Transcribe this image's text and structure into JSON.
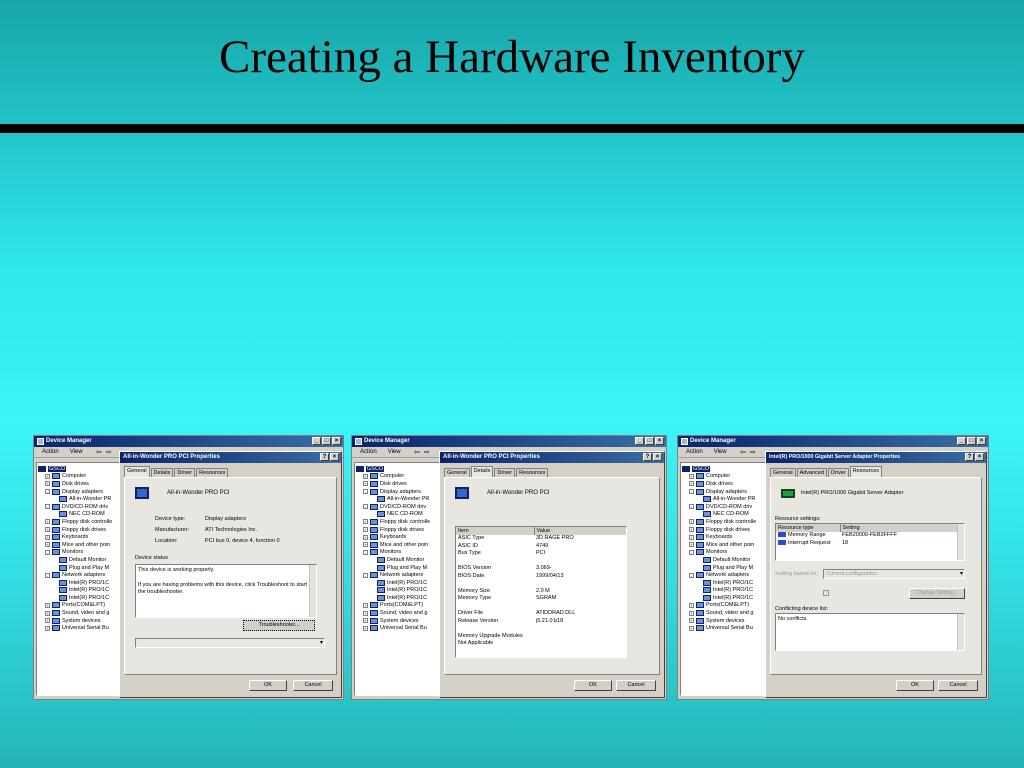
{
  "slide_title": "Creating a Hardware Inventory",
  "device_manager": {
    "title": "Device Manager",
    "menu": [
      "Action",
      "View"
    ],
    "tree": [
      {
        "label": "GSCO",
        "level": 0,
        "root": true
      },
      {
        "label": "Computer",
        "level": 1,
        "exp": "+"
      },
      {
        "label": "Disk drives",
        "level": 1,
        "exp": "+"
      },
      {
        "label": "Display adapters",
        "level": 1,
        "exp": "-"
      },
      {
        "label": "All-in-Wonder PR",
        "level": 2
      },
      {
        "label": "DVD/CD-ROM driv",
        "level": 1,
        "exp": "-"
      },
      {
        "label": "NEC CD-ROM",
        "level": 2
      },
      {
        "label": "Floppy disk controlle",
        "level": 1,
        "exp": "+"
      },
      {
        "label": "Floppy disk drives",
        "level": 1,
        "exp": "+"
      },
      {
        "label": "Keyboards",
        "level": 1,
        "exp": "+"
      },
      {
        "label": "Mice and other poin",
        "level": 1,
        "exp": "+"
      },
      {
        "label": "Monitors",
        "level": 1,
        "exp": "-"
      },
      {
        "label": "Default Monitor",
        "level": 2
      },
      {
        "label": "Plug and Play M",
        "level": 2
      },
      {
        "label": "Network adapters",
        "level": 1,
        "exp": "-"
      },
      {
        "label": "Intel(R) PRO/1C",
        "level": 2
      },
      {
        "label": "Intel(R) PRO/1C",
        "level": 2
      },
      {
        "label": "Intel(R) PRO/1C",
        "level": 2
      },
      {
        "label": "Ports(COM&LPT)",
        "level": 1,
        "exp": "+"
      },
      {
        "label": "Sound, video and g",
        "level": 1,
        "exp": "+"
      },
      {
        "label": "System devices",
        "level": 1,
        "exp": "+"
      },
      {
        "label": "Universal Serial Bu",
        "level": 1,
        "exp": "+"
      }
    ]
  },
  "ok_label": "OK",
  "cancel_label": "Cancel",
  "dialog1": {
    "title": "All-in-Wonder PRO PCI Properties",
    "tabs": [
      "General",
      "Details",
      "Driver",
      "Resources"
    ],
    "device_name": "All-in-Wonder PRO PCI",
    "rows": [
      {
        "key": "Device type:",
        "value": "Display adapters"
      },
      {
        "key": "Manufacturer:",
        "value": "ATI Technologies Inc."
      },
      {
        "key": "Location:",
        "value": "PCI bus 0, device 4, function 0"
      }
    ],
    "status_label": "Device status",
    "status_text": "This device is working properly.",
    "status_text2": "If you are having problems with this device, click Troubleshoot to start the troubleshooter.",
    "troubleshoot_label": "Troubleshooter..."
  },
  "dialog2": {
    "title": "All-in-Wonder PRO PCI Properties",
    "tabs": [
      "General",
      "Details",
      "Driver",
      "Resources"
    ],
    "device_name": "All-in-Wonder PRO PCI",
    "headers": [
      "Item",
      "Value"
    ],
    "rows": [
      {
        "item": "ASIC Type",
        "value": "3D RAGE PRO"
      },
      {
        "item": "ASIC ID",
        "value": "4749"
      },
      {
        "item": "Bus Type",
        "value": "PCI"
      },
      {
        "item": "",
        "value": ""
      },
      {
        "item": "BIOS Version",
        "value": "3.069-"
      },
      {
        "item": "BIOS Date",
        "value": "1999/04/13"
      },
      {
        "item": "",
        "value": ""
      },
      {
        "item": "Memory Size",
        "value": "2.0 M"
      },
      {
        "item": "Memory Type",
        "value": "SGRAM"
      },
      {
        "item": "",
        "value": ""
      },
      {
        "item": "Driver File",
        "value": "ATIDDRAD.DLL"
      },
      {
        "item": "Release Version",
        "value": "j5.21.0.b18"
      },
      {
        "item": "",
        "value": ""
      },
      {
        "item": "Memory Upgrade Modules",
        "value": ""
      },
      {
        "item": "Not Applicable",
        "value": ""
      }
    ]
  },
  "dialog3": {
    "title": "Intel(R) PRO/1000 Gigabit Server Adapter Properties",
    "tabs": [
      "General",
      "Advanced",
      "Driver",
      "Resources"
    ],
    "device_name": "Intel(R) PRO/1000 Gigabit Server Adapter",
    "resource_label": "Resource settings:",
    "headers": [
      "Resource type",
      "Setting"
    ],
    "rows": [
      {
        "type": "Memory Range",
        "setting": "FEB20000-FEB3FFFF"
      },
      {
        "type": "Interrupt Request",
        "setting": "18"
      }
    ],
    "setting_based_label": "Setting based on:",
    "setting_based_value": "Current configuration",
    "change_label": "Change Setting...",
    "conflict_label": "Conflicting device list:",
    "conflict_value": "No conflicts."
  }
}
